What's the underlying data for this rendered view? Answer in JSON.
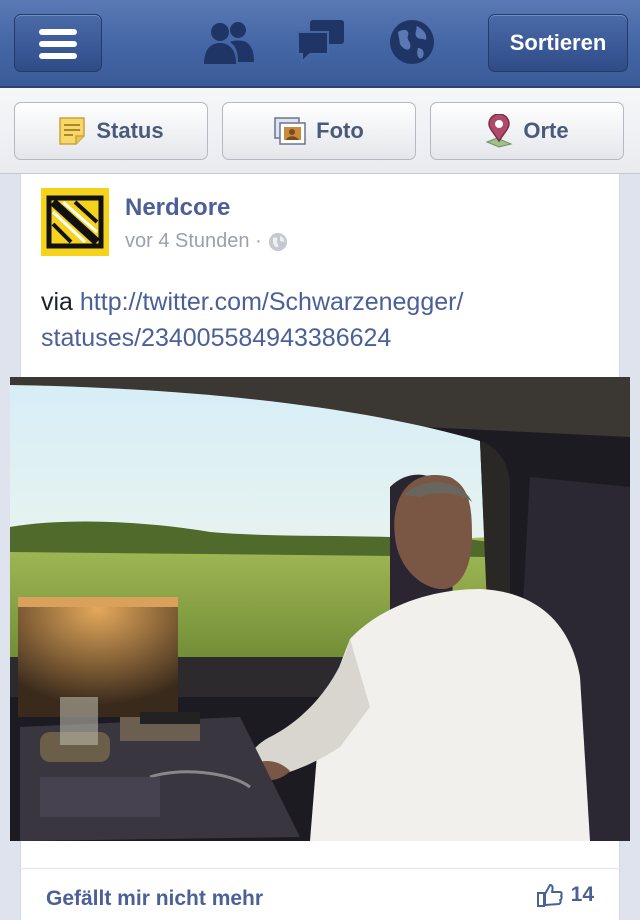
{
  "navbar": {
    "sort_label": "Sortieren",
    "icons": [
      "friend-requests-icon",
      "messages-icon",
      "notifications-globe-icon"
    ]
  },
  "composer": {
    "status_label": "Status",
    "photo_label": "Foto",
    "places_label": "Orte"
  },
  "post": {
    "author": "Nerdcore",
    "time": "vor 4 Stunden ·",
    "text_prefix": "via ",
    "link": "http://twitter.com/Schwarzenegger/statuses/234005584943386624",
    "link_line1": "http://twitter.com/Schwarzenegger/",
    "link_line2": "statuses/234005584943386624"
  },
  "actions": {
    "unlike_label": "Gefällt mir nicht mehr",
    "like_count": "14"
  },
  "colors": {
    "nav_blue": "#3b5a98",
    "link_blue": "#4a6096",
    "avatar_yellow": "#f5d31a"
  }
}
